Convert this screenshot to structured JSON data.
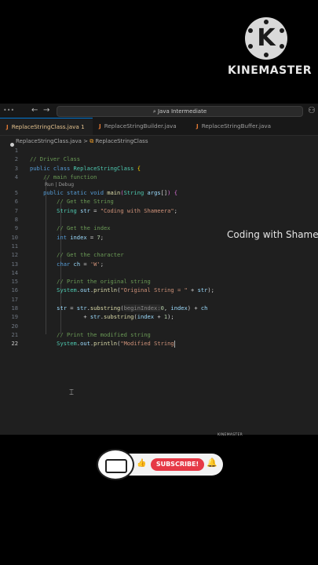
{
  "watermark": {
    "logo_letter": "K",
    "brand": "KINEMASTER",
    "brand_small": "KINEMASTER"
  },
  "titlebar": {
    "search_text": "⌕ Java Intermediate",
    "back": "←",
    "forward": "→"
  },
  "tabs": [
    {
      "label": "ReplaceStringClass.java",
      "badge": "1",
      "active": true
    },
    {
      "label": "ReplaceStringBuilder.java",
      "active": false
    },
    {
      "label": "ReplaceStringBuffer.java",
      "active": false
    }
  ],
  "breadcrumb": {
    "file": "ReplaceStringClass.java",
    "sep": ">",
    "symbol": "ReplaceStringClass"
  },
  "codelens": "Run | Debug",
  "overlay_text": "Coding with Shameera",
  "subscribe": {
    "label": "SUBSCRIBE!"
  },
  "colors": {
    "editor_bg": "#1f1f1f",
    "accent": "#0078d4",
    "subscribe": "#e63946"
  }
}
